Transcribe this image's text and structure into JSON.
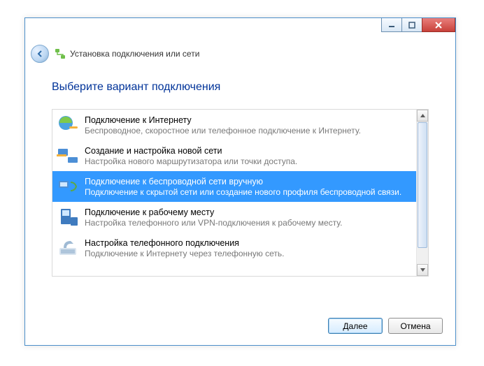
{
  "window": {
    "header_title": "Установка подключения или сети",
    "page_title": "Выберите вариант подключения"
  },
  "options": [
    {
      "title": "Подключение к Интернету",
      "desc": "Беспроводное, скоростное или телефонное подключение к Интернету.",
      "selected": false
    },
    {
      "title": "Создание и настройка новой сети",
      "desc": "Настройка нового маршрутизатора или точки доступа.",
      "selected": false
    },
    {
      "title": "Подключение к беспроводной сети вручную",
      "desc": "Подключение к скрытой сети или создание нового профиля беспроводной связи.",
      "selected": true
    },
    {
      "title": "Подключение к рабочему месту",
      "desc": "Настройка телефонного или VPN-подключения к рабочему месту.",
      "selected": false
    },
    {
      "title": "Настройка телефонного подключения",
      "desc": "Подключение к Интернету через телефонную сеть.",
      "selected": false
    }
  ],
  "footer": {
    "next": "Далее",
    "cancel": "Отмена"
  }
}
